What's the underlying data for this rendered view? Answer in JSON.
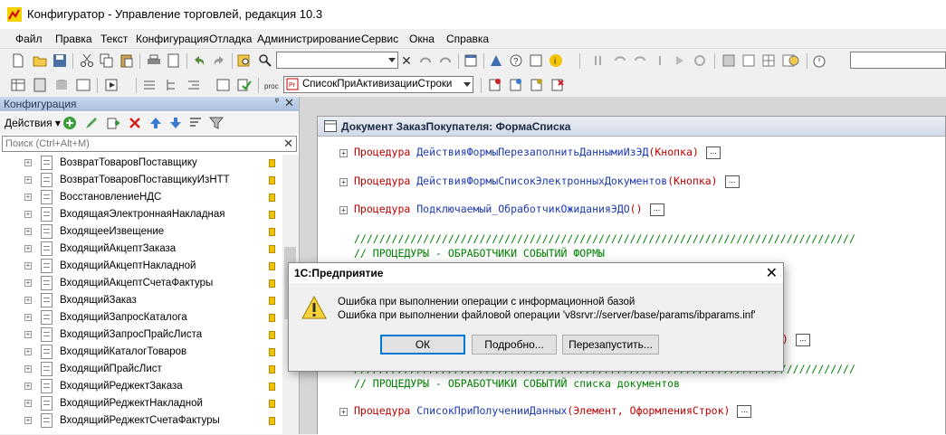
{
  "window": {
    "title": "Конфигуратор - Управление торговлей, редакция 10.3"
  },
  "menu": [
    "Файл",
    "Правка",
    "Текст",
    "Конфигурация",
    "Отладка",
    "Администрирование",
    "Сервис",
    "Окна",
    "Справка"
  ],
  "toolbar2": {
    "procedure_combo": "СписокПриАктивизацииСтроки"
  },
  "config_panel": {
    "title": "Конфигурация",
    "actions_label": "Действия",
    "search_placeholder": "Поиск (Ctrl+Alt+M)",
    "items": [
      "ВозвратТоваровПоставщику",
      "ВозвратТоваровПоставщикуИзНТТ",
      "ВосстановлениеНДС",
      "ВходящаяЭлектроннаяНакладная",
      "ВходящееИзвещение",
      "ВходящийАкцептЗаказа",
      "ВходящийАкцептНакладной",
      "ВходящийАкцептСчетаФактуры",
      "ВходящийЗаказ",
      "ВходящийЗапросКаталога",
      "ВходящийЗапросПрайсЛиста",
      "ВходящийКаталогТоваров",
      "ВходящийПрайсЛист",
      "ВходящийРеджектЗаказа",
      "ВходящийРеджектНакладной",
      "ВходящийРеджектСчетаФактуры"
    ]
  },
  "form": {
    "title": "Документ ЗаказПокупателя: ФормаСписка",
    "code": {
      "kw": "Процедура",
      "proc1": "ДействияФормыПерезаполнитьДаннымиИзЭД",
      "proc1_args": "(Кнопка)",
      "proc2": "ДействияФормыСписокЭлектронныхДокументов",
      "proc2_args": "(Кнопка)",
      "proc3": "Подключаемый_ОбработчикОжиданияЭДО",
      "proc3_args": "()",
      "slashes": "////////////////////////////////////////////////////////////////////////////////",
      "comment1": "// ПРОЦЕДУРЫ - ОБРАБОТЧИКИ СОБЫТИЙ ФОРМЫ",
      "partial_k": "к)",
      "comment2": "// ПРОЦЕДУРЫ - ОБРАБОТЧИКИ СОБЫТИЙ списка документов",
      "proc4": "СписокПриПолученииДанных",
      "proc4_args": "(Элемент, ОформленияСтрок)",
      "ellipsis": "..."
    }
  },
  "dialog": {
    "title": "1С:Предприятие",
    "line1": "Ошибка при выполнении операции с информационной базой",
    "line2": "Ошибка при выполнении файловой операции 'v8srvr://server/base/params/ibparams.inf'",
    "ok": "ОК",
    "details": "Подробно...",
    "restart": "Перезапустить..."
  },
  "colors": {
    "keyword": "#c00000",
    "name": "#1b3ab4",
    "comment": "#008000",
    "panel_header": "#b9cce8"
  }
}
